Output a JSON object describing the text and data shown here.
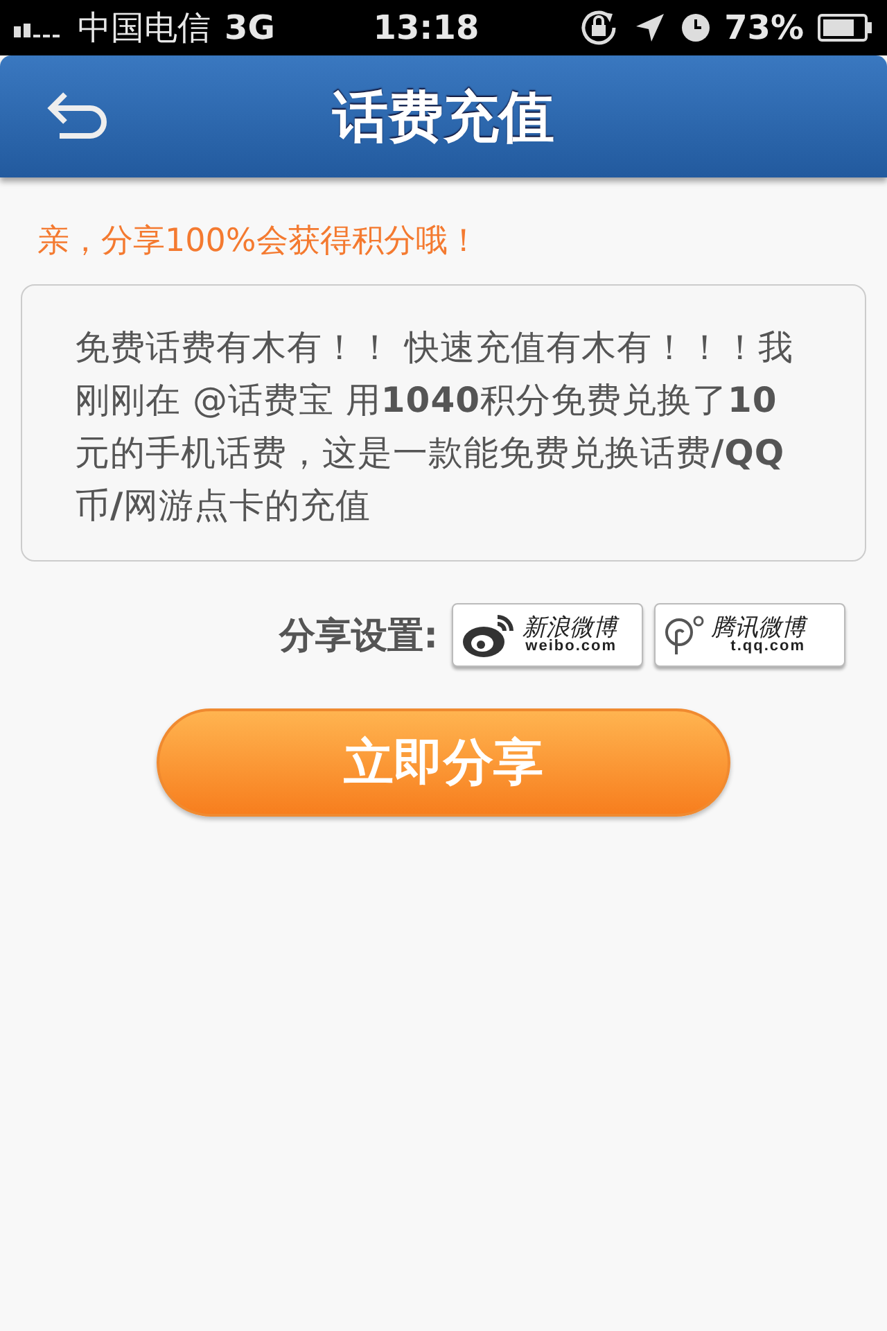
{
  "status_bar": {
    "carrier": "中国电信",
    "network": "3G",
    "time": "13:18",
    "battery": "73%"
  },
  "nav_bar": {
    "title": "话费充值"
  },
  "hint": "亲，分享100%会获得积分哦！",
  "message": "免费话费有木有！！ 快速充值有木有！！！我刚刚在 @话费宝 用**1040**积分免费兑换了**10**元的手机话费，这是一款能免费兑换话费**/QQ**币**/**网游点卡的充值",
  "share_settings": {
    "label": "分享设置:",
    "services": [
      {
        "kind": "weibo",
        "name": "新浪微博",
        "domain": "weibo.com",
        "selected": false
      },
      {
        "kind": "tencent",
        "name": "腾讯微博",
        "domain": "t.qq.com",
        "selected": false
      }
    ]
  },
  "share_button": "立即分享"
}
